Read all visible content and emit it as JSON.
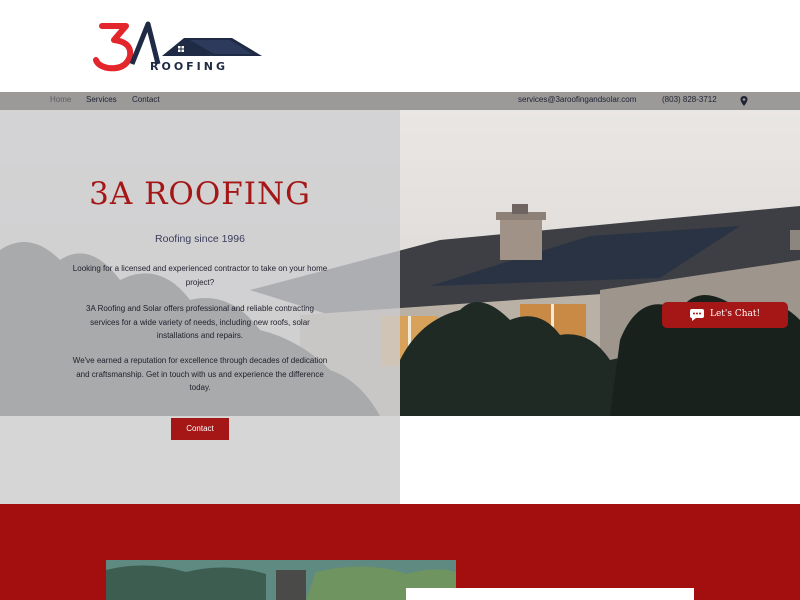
{
  "brand": {
    "logo_mark": "3A",
    "logo_word": "ROOFING",
    "colors": {
      "accent": "#a51616",
      "navy": "#1f2a44",
      "nav_bg": "#9b9a98"
    }
  },
  "nav": {
    "items": [
      {
        "label": "Home",
        "active": true
      },
      {
        "label": "Services"
      },
      {
        "label": "Contact"
      }
    ],
    "email": "services@3aroofingandsolar.com",
    "phone": "(803) 828-3712",
    "location_icon": "map-pin-icon"
  },
  "hero": {
    "title": "3A ROOFING",
    "subtitle": "Roofing since 1996",
    "paragraphs": [
      "Looking for a licensed and experienced contractor to take on your home project?",
      "3A Roofing and Solar offers professional and reliable contracting services for a wide variety of needs, including new roofs, solar installations and repairs.",
      "We've earned a reputation for excellence through decades of dedication and craftsmanship. Get in touch with us and experience the difference today."
    ],
    "cta_label": "Contact"
  },
  "chat": {
    "label": "Let's Chat!",
    "icon": "chat-bubble-icon"
  }
}
